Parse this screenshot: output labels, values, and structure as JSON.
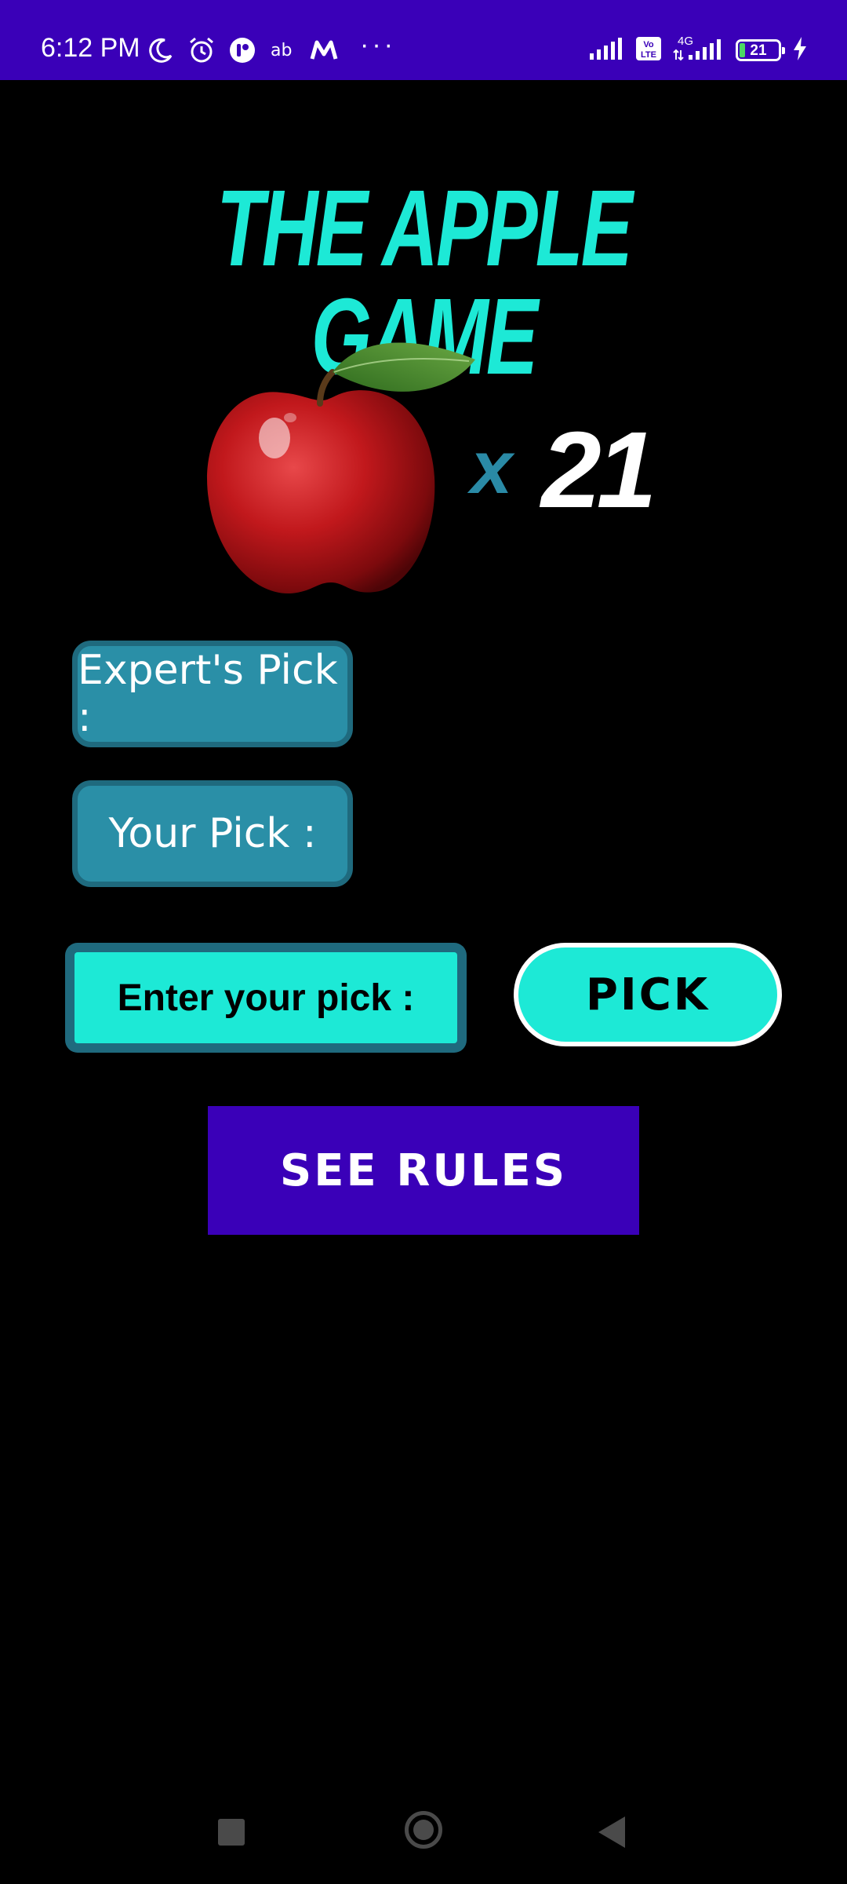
{
  "status_bar": {
    "time": "6:12 PM",
    "battery_level": "21",
    "network": "4G",
    "volte_label": "Vo LTE",
    "overflow_dots": "···",
    "left_icons": [
      "moon-icon",
      "alarm-icon",
      "app-notification-icon",
      "ab-app-icon",
      "myntra-icon"
    ],
    "right_icons": [
      "signal-icon",
      "volte-icon",
      "signal-4g-icon",
      "battery-icon",
      "charging-icon"
    ]
  },
  "game": {
    "title": "THE APPLE GAME",
    "apple_multiplier": "x",
    "apple_count": "21",
    "expert_pick_label": "Expert's Pick :",
    "your_pick_label": "Your Pick :",
    "input_placeholder": "Enter your pick :",
    "input_value": "",
    "pick_button_label": "PICK",
    "see_rules_label": "SEE RULES"
  },
  "colors": {
    "status_bar_bg": "#3a00b8",
    "background": "#000000",
    "title": "#1de9d6",
    "accent_teal": "#2a8fa7",
    "button_cyan": "#1de9d6",
    "rules_button_bg": "#3a00b8"
  },
  "nav_bar": {
    "icons": [
      "recents-icon",
      "home-icon",
      "back-icon"
    ]
  }
}
